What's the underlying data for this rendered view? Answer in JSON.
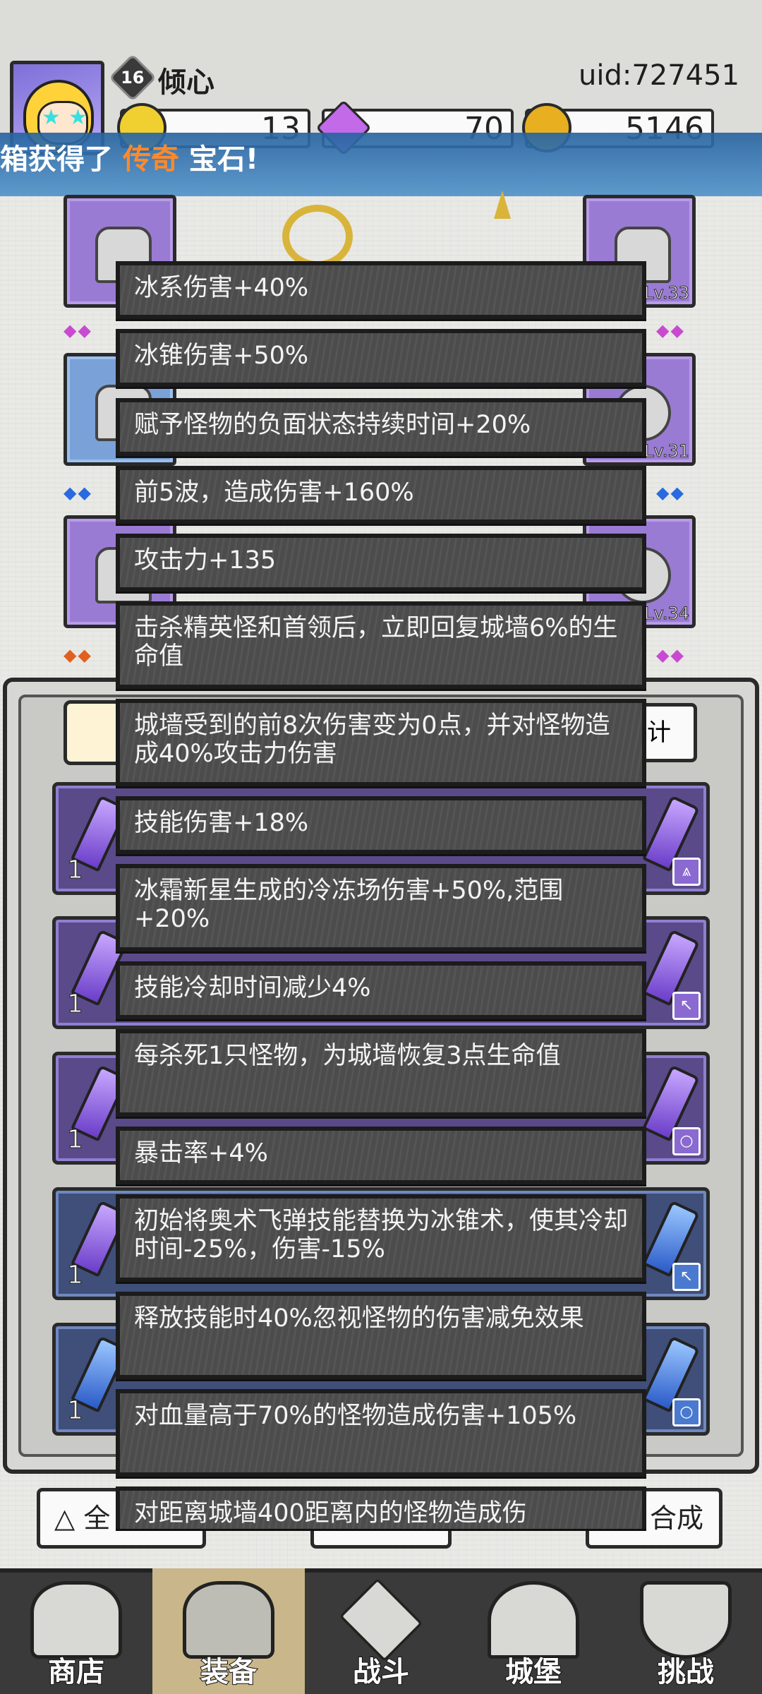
{
  "player": {
    "level": "16",
    "name": "倾心",
    "uid": "uid:727451"
  },
  "resources": [
    {
      "icon": "yellow-crystal-icon",
      "value": "13",
      "color": "#f0d030"
    },
    {
      "icon": "purple-diamond-icon",
      "value": "70",
      "color": "#c26ae8"
    },
    {
      "icon": "gold-coin-icon",
      "value": "5146",
      "color": "#e8b020"
    }
  ],
  "banner": {
    "prefix": "箱获得了",
    "highlight": "传奇",
    "suffix": "宝石!"
  },
  "equipment": {
    "right_levels": [
      "Lv.33",
      "Lv.31",
      "Lv.34"
    ]
  },
  "panel": {
    "stat_button": "计",
    "gem_counts": [
      "1",
      "1",
      "1",
      "1",
      "1"
    ]
  },
  "bottom_buttons": {
    "left": "全",
    "right": "合成"
  },
  "affixes": [
    "冰系伤害+40%",
    "冰锥伤害+50%",
    "赋予怪物的负面状态持续时间+20%",
    "前5波，造成伤害+160%",
    "攻击力+135",
    "击杀精英怪和首领后，立即回复城墙6%的生命值",
    "城墙受到的前8次伤害变为0点，并对怪物造成40%攻击力伤害",
    "技能伤害+18%",
    "冰霜新星生成的冷冻场伤害+50%,范围+20%",
    "技能冷却时间减少4%",
    "每杀死1只怪物，为城墙恢复3点生命值",
    "暴击率+4%",
    "初始将奥术飞弹技能替换为冰锥术，使其冷却时间-25%，伤害-15%",
    "释放技能时40%忽视怪物的伤害减免效果",
    "对血量高于70%的怪物造成伤害+105%",
    "对距离城墙400距离内的怪物造成伤"
  ],
  "nav": [
    {
      "label": "商店",
      "icon": "shop-icon"
    },
    {
      "label": "装备",
      "icon": "backpack-icon"
    },
    {
      "label": "战斗",
      "icon": "crossed-swords-icon"
    },
    {
      "label": "城堡",
      "icon": "castle-icon"
    },
    {
      "label": "挑战",
      "icon": "shield-icon"
    }
  ]
}
